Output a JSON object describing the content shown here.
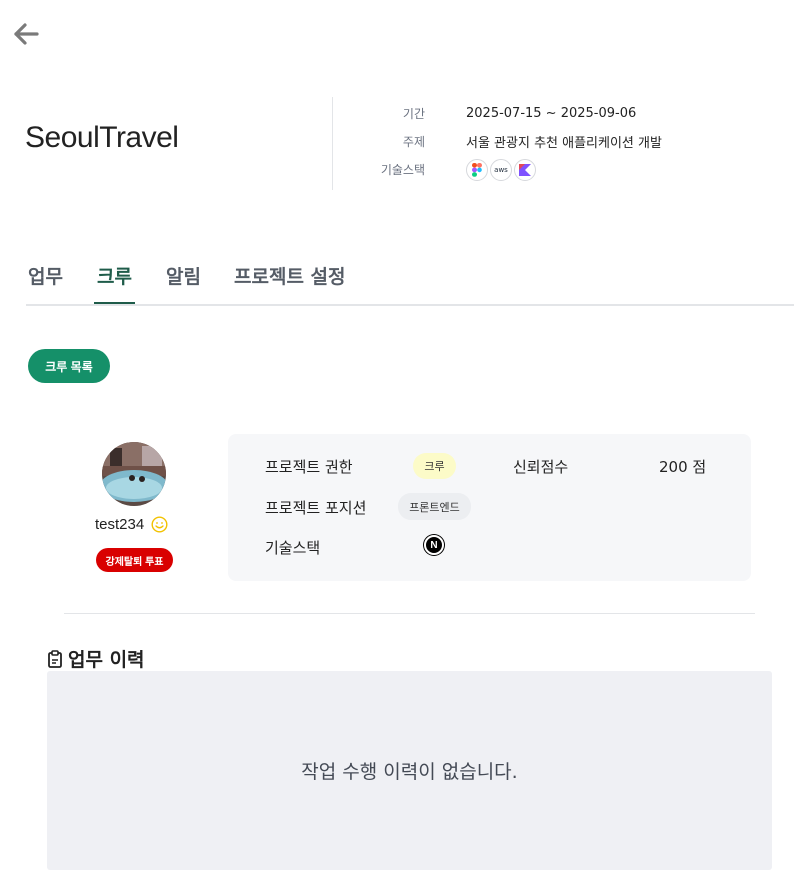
{
  "header": {
    "project_name": "SeoulTravel"
  },
  "meta": {
    "period_label": "기간",
    "period_value": "2025-07-15 ~ 2025-09-06",
    "topic_label": "주제",
    "topic_value": "서울 관광지 추천 애플리케이션 개발",
    "stack_label": "기술스택",
    "stack_icons": [
      "figma-icon",
      "aws-icon",
      "kotlin-icon"
    ],
    "aws_text": "aws"
  },
  "tabs": [
    {
      "label": "업무",
      "active": false
    },
    {
      "label": "크루",
      "active": true
    },
    {
      "label": "알림",
      "active": false
    },
    {
      "label": "프로젝트 설정",
      "active": false
    }
  ],
  "crew_list_button": "크루 목록",
  "member": {
    "username": "test234",
    "kick_vote_label": "강제탈퇴 투표",
    "role_label": "프로젝트 권한",
    "role_value": "크루",
    "position_label": "프로젝트 포지션",
    "position_value": "프론트엔드",
    "stack_label": "기술스택",
    "stack_icon": "nextjs-icon",
    "stack_icon_letter": "N",
    "trust_label": "신뢰점수",
    "trust_value": "200 점"
  },
  "history": {
    "title": "업무 이력",
    "empty_message": "작업 수행 이력이 없습니다."
  },
  "colors": {
    "accent_green": "#159069",
    "tab_active": "#1f5c4a",
    "danger_red": "#d90000",
    "role_badge_bg": "#fcfbc8",
    "card_bg": "#f6f7f9",
    "history_bg": "#eff0f4"
  }
}
